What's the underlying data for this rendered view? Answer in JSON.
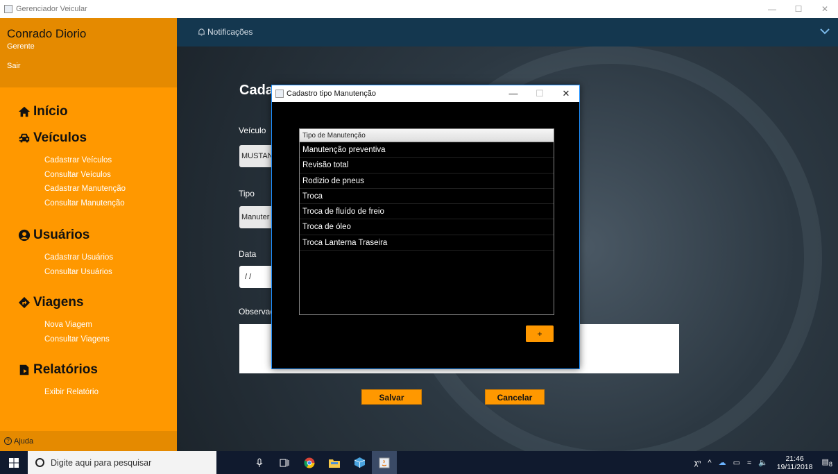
{
  "window": {
    "title": "Gerenciador Veicular",
    "minimize": "—",
    "maximize": "☐",
    "close": "✕"
  },
  "sidebar": {
    "user_name": "Conrado Diorio",
    "user_role": "Gerente",
    "logout": "Sair",
    "menu": [
      {
        "id": "inicio",
        "label": "Início",
        "icon": "home-icon",
        "items": []
      },
      {
        "id": "veiculos",
        "label": "Veículos",
        "icon": "car-icon",
        "items": [
          "Cadastrar Veículos",
          "Consultar Veículos",
          "Cadastrar Manutenção",
          "Consultar Manutenção"
        ]
      },
      {
        "id": "usuarios",
        "label": "Usuários",
        "icon": "user-icon",
        "items": [
          "Cadastrar Usuários",
          "Consultar Usuários"
        ]
      },
      {
        "id": "viagens",
        "label": "Viagens",
        "icon": "direction-icon",
        "items": [
          "Nova Viagem",
          "Consultar Viagens"
        ]
      },
      {
        "id": "relatorios",
        "label": "Relatórios",
        "icon": "report-icon",
        "items": [
          "Exibir Relatório"
        ]
      }
    ],
    "help": "Ajuda"
  },
  "topbar": {
    "notifications": "Notificações"
  },
  "form": {
    "title": "Cada",
    "vehicle_label": "Veículo",
    "vehicle_value": "MUSTAN",
    "type_label": "Tipo",
    "type_value": "Manuter",
    "date_label": "Data",
    "date_value": "/ /",
    "notes_label": "Observaç",
    "save": "Salvar",
    "cancel": "Cancelar"
  },
  "dialog": {
    "title": "Cadastro tipo Manutenção",
    "minimize": "—",
    "maximize": "☐",
    "close": "✕",
    "table_header": "Tipo de Manutenção",
    "rows": [
      "Manutenção preventiva",
      "Revisão total",
      "Rodizio de pneus",
      "Troca",
      "Troca de fluído de freio",
      "Troca de óleo",
      "Troca Lanterna Traseira"
    ],
    "add_button": "+"
  },
  "taskbar": {
    "search_placeholder": "Digite aqui para pesquisar",
    "time": "21:46",
    "date": "19/11/2018",
    "notifications_count": "8"
  },
  "colors": {
    "sidebar": "#ff9800",
    "sidebar_header": "#e58a00",
    "topbar": "#14374f",
    "accent": "#ff9800"
  }
}
